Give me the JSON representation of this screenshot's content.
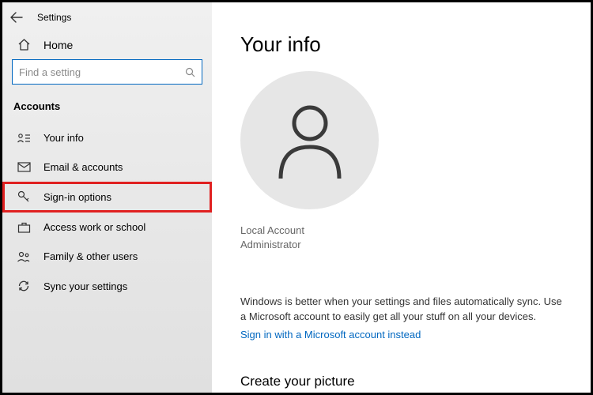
{
  "header": {
    "title": "Settings"
  },
  "sidebar": {
    "home_label": "Home",
    "search_placeholder": "Find a setting",
    "section": "Accounts",
    "items": [
      {
        "label": "Your info"
      },
      {
        "label": "Email & accounts"
      },
      {
        "label": "Sign-in options"
      },
      {
        "label": "Access work or school"
      },
      {
        "label": "Family & other users"
      },
      {
        "label": "Sync your settings"
      }
    ]
  },
  "main": {
    "heading": "Your info",
    "account_type": "Local Account",
    "account_role": "Administrator",
    "sync_text": "Windows is better when your settings and files automatically sync. Use a Microsoft account to easily get all your stuff on all your devices.",
    "sync_link": "Sign in with a Microsoft account instead",
    "picture_heading": "Create your picture"
  }
}
